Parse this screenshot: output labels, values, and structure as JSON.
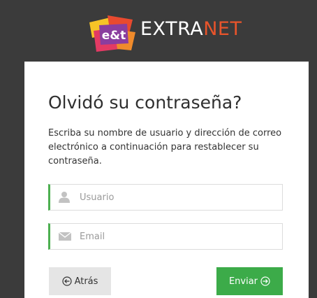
{
  "header": {
    "logo_text": "e&t",
    "brand_part1": "EXTRA",
    "brand_part2": "NET"
  },
  "form": {
    "title": "Olvidó su contraseña?",
    "description": "Escriba su nombre de usuario y dirección de correo electrónico a continuación para restablecer su contraseña.",
    "username_placeholder": "Usuario",
    "email_placeholder": "Email",
    "back_label": "Atrás",
    "send_label": "Enviar"
  },
  "icons": {
    "username": "user-icon",
    "email": "envelope-icon",
    "back": "arrow-circle-left-icon",
    "send": "arrow-circle-right-icon"
  },
  "colors": {
    "background": "#3b3b3b",
    "brand_accent": "#e8542b",
    "field_accent": "#4caf50",
    "send_button": "#3cab49",
    "back_button": "#e5e5e5"
  }
}
